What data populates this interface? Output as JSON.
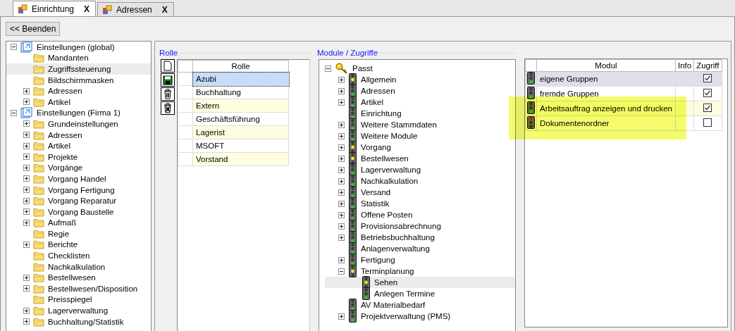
{
  "tabs": [
    {
      "label": "Einrichtung",
      "close": "X",
      "selected": true
    },
    {
      "label": "Adressen",
      "close": "X",
      "selected": false
    }
  ],
  "toolbar": {
    "exit_button": "<< Beenden"
  },
  "settings_tree": [
    {
      "label": "Einstellungen (global)",
      "kind": "branch",
      "expanded": true,
      "selected": false,
      "children": [
        {
          "label": "Mandanten",
          "kind": "leaf",
          "selected": false
        },
        {
          "label": "Zugriffssteuerung",
          "kind": "leaf",
          "selected": true
        },
        {
          "label": "Bildschirmmasken",
          "kind": "leaf",
          "selected": false
        },
        {
          "label": "Adressen",
          "kind": "branch",
          "expanded": false,
          "selected": false
        },
        {
          "label": "Artikel",
          "kind": "branch",
          "expanded": false,
          "selected": false
        }
      ]
    },
    {
      "label": "Einstellungen (Firma 1)",
      "kind": "branch",
      "expanded": true,
      "selected": false,
      "children": [
        {
          "label": "Grundeinstellungen",
          "kind": "branch",
          "expanded": false,
          "selected": false
        },
        {
          "label": "Adressen",
          "kind": "branch",
          "expanded": false,
          "selected": false
        },
        {
          "label": "Artikel",
          "kind": "branch",
          "expanded": false,
          "selected": false
        },
        {
          "label": "Projekte",
          "kind": "branch",
          "expanded": false,
          "selected": false
        },
        {
          "label": "Vorgänge",
          "kind": "branch",
          "expanded": false,
          "selected": false
        },
        {
          "label": "Vorgang Handel",
          "kind": "branch",
          "expanded": false,
          "selected": false
        },
        {
          "label": "Vorgang Fertigung",
          "kind": "branch",
          "expanded": false,
          "selected": false
        },
        {
          "label": "Vorgang Reparatur",
          "kind": "branch",
          "expanded": false,
          "selected": false
        },
        {
          "label": "Vorgang Baustelle",
          "kind": "branch",
          "expanded": false,
          "selected": false
        },
        {
          "label": "Aufmaß",
          "kind": "branch",
          "expanded": false,
          "selected": false
        },
        {
          "label": "Regie",
          "kind": "leaf",
          "selected": false
        },
        {
          "label": "Berichte",
          "kind": "branch",
          "expanded": false,
          "selected": false
        },
        {
          "label": "Checklisten",
          "kind": "leaf",
          "selected": false
        },
        {
          "label": "Nachkalkulation",
          "kind": "leaf",
          "selected": false
        },
        {
          "label": "Bestellwesen",
          "kind": "branch",
          "expanded": false,
          "selected": false
        },
        {
          "label": "Bestellwesen/Disposition",
          "kind": "branch",
          "expanded": false,
          "selected": false
        },
        {
          "label": "Preisspiegel",
          "kind": "leaf",
          "selected": false
        },
        {
          "label": "Lagerverwaltung",
          "kind": "branch",
          "expanded": false,
          "selected": false
        },
        {
          "label": "Buchhaltung/Statistik",
          "kind": "branch",
          "expanded": false,
          "selected": false
        }
      ]
    }
  ],
  "roles": {
    "title": "Rolle",
    "column": "Rolle",
    "rows": [
      {
        "name": "Azubi",
        "selected": true
      },
      {
        "name": "Buchhaltung",
        "selected": false
      },
      {
        "name": "Extern",
        "selected": false
      },
      {
        "name": "Geschäftsführung",
        "selected": false
      },
      {
        "name": "Lagerist",
        "selected": false
      },
      {
        "name": "MSOFT",
        "selected": false
      },
      {
        "name": "Vorstand",
        "selected": false
      }
    ]
  },
  "modules": {
    "title": "Module / Zugriffe",
    "tree": [
      {
        "label": "Passt",
        "kind": "branch",
        "expanded": true,
        "selected": false,
        "children": [
          {
            "label": "Allgemein",
            "color": "#ffe600",
            "kind": "branch",
            "expanded": false,
            "selected": false
          },
          {
            "label": "Adressen",
            "color": "#19d219",
            "kind": "branch",
            "expanded": false,
            "selected": false
          },
          {
            "label": "Artikel",
            "color": "#19d219",
            "kind": "branch",
            "expanded": false,
            "selected": false
          },
          {
            "label": "Einrichtung",
            "color": "#19d219",
            "kind": "leaf",
            "selected": false
          },
          {
            "label": "Weitere Stammdaten",
            "color": "#19d219",
            "kind": "branch",
            "expanded": false,
            "selected": false
          },
          {
            "label": "Weitere Module",
            "color": "#19d219",
            "kind": "branch",
            "expanded": false,
            "selected": false
          },
          {
            "label": "Vorgang",
            "color": "#ffe600",
            "kind": "branch",
            "expanded": false,
            "selected": false
          },
          {
            "label": "Bestellwesen",
            "color": "#ffe600",
            "kind": "branch",
            "expanded": false,
            "selected": false
          },
          {
            "label": "Lagerverwaltung",
            "color": "#19d219",
            "kind": "branch",
            "expanded": false,
            "selected": false
          },
          {
            "label": "Nachkalkulation",
            "color": "#19d219",
            "kind": "branch",
            "expanded": false,
            "selected": false
          },
          {
            "label": "Versand",
            "color": "#19d219",
            "kind": "branch",
            "expanded": false,
            "selected": false
          },
          {
            "label": "Statistik",
            "color": "#19d219",
            "kind": "branch",
            "expanded": false,
            "selected": false
          },
          {
            "label": "Offene Posten",
            "color": "#19d219",
            "kind": "branch",
            "expanded": false,
            "selected": false
          },
          {
            "label": "Provisionsabrechnung",
            "color": "#19d219",
            "kind": "branch",
            "expanded": false,
            "selected": false
          },
          {
            "label": "Betriebsbuchhaltung",
            "color": "#19d219",
            "kind": "branch",
            "expanded": false,
            "selected": false
          },
          {
            "label": "Anlagenverwaltung",
            "color": "#19d219",
            "kind": "leaf",
            "selected": false
          },
          {
            "label": "Fertigung",
            "color": "#19d219",
            "kind": "branch",
            "expanded": false,
            "selected": false
          },
          {
            "label": "Terminplanung",
            "color": "#ffe600",
            "kind": "branch",
            "expanded": true,
            "selected": false,
            "children": [
              {
                "label": "Sehen",
                "color": "#ffe600",
                "kind": "leaf",
                "selected": true
              },
              {
                "label": "Anlegen Termine",
                "color": "#19d219",
                "kind": "leaf",
                "selected": false
              }
            ]
          },
          {
            "label": "AV Materialbedarf",
            "color": "#19d219",
            "kind": "leaf",
            "selected": false
          },
          {
            "label": "Projektverwaltung (PMS)",
            "color": "#19d219",
            "kind": "branch",
            "expanded": false,
            "selected": false
          }
        ]
      }
    ]
  },
  "access": {
    "columns": [
      "Modul",
      "Info",
      "Zugriff"
    ],
    "rows": [
      {
        "module": "eigene Gruppen",
        "color": "#19d219",
        "checked": true,
        "selected": true
      },
      {
        "module": "fremde Gruppen",
        "color": "#19d219",
        "checked": true,
        "selected": false
      },
      {
        "module": "Arbeitsauftrag anzeigen und drucken",
        "color": "#19d219",
        "checked": true,
        "selected": false
      },
      {
        "module": "Dokumentenordner",
        "color": "#e01010",
        "checked": false,
        "selected": false
      }
    ]
  }
}
